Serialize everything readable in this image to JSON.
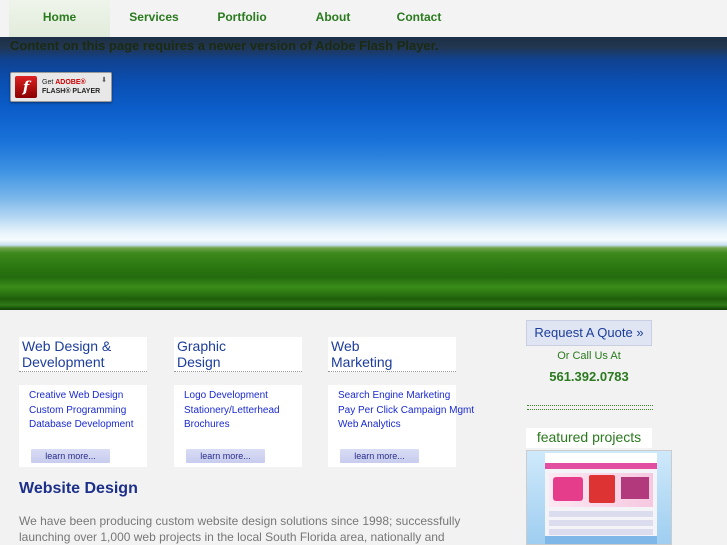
{
  "nav": {
    "items": [
      {
        "label": "Home",
        "active": true
      },
      {
        "label": "Services",
        "active": false
      },
      {
        "label": "Portfolio",
        "active": false
      },
      {
        "label": "About",
        "active": false
      },
      {
        "label": "Contact",
        "active": false
      }
    ]
  },
  "hero": {
    "flash_message": "Content on this page requires a newer version of Adobe Flash Player.",
    "flash_button": {
      "line1_prefix": "Get ",
      "line1_brand": "ADOBE®",
      "line2": "FLASH® PLAYER",
      "icon": "flash-icon"
    }
  },
  "services": [
    {
      "title": "Web Design &\nDevelopment",
      "links": [
        "Creative Web Design",
        "Custom Programming",
        "Database Development"
      ],
      "learn_more": "learn more..."
    },
    {
      "title": "Graphic\nDesign",
      "links": [
        "Logo Development",
        "Stationery/Letterhead",
        "Brochures"
      ],
      "learn_more": "learn more..."
    },
    {
      "title": "Web\nMarketing",
      "links": [
        "Search Engine Marketing",
        "Pay Per Click Campaign Mgmt",
        "Web Analytics"
      ],
      "learn_more": "learn more..."
    }
  ],
  "main": {
    "title": "Website Design",
    "text": "We have been producing custom website design solutions since 1998; successfully launching over 1,000 web projects in the local South Florida area, nationally and"
  },
  "sidebar": {
    "quote_button": "Request A Quote »",
    "call_us": "Or Call Us At",
    "phone": "561.392.0783",
    "featured_heading": "featured projects"
  },
  "colors": {
    "accent_green": "#2a7a1e",
    "accent_blue": "#1c3d9a",
    "link_blue": "#1a2ad0"
  }
}
